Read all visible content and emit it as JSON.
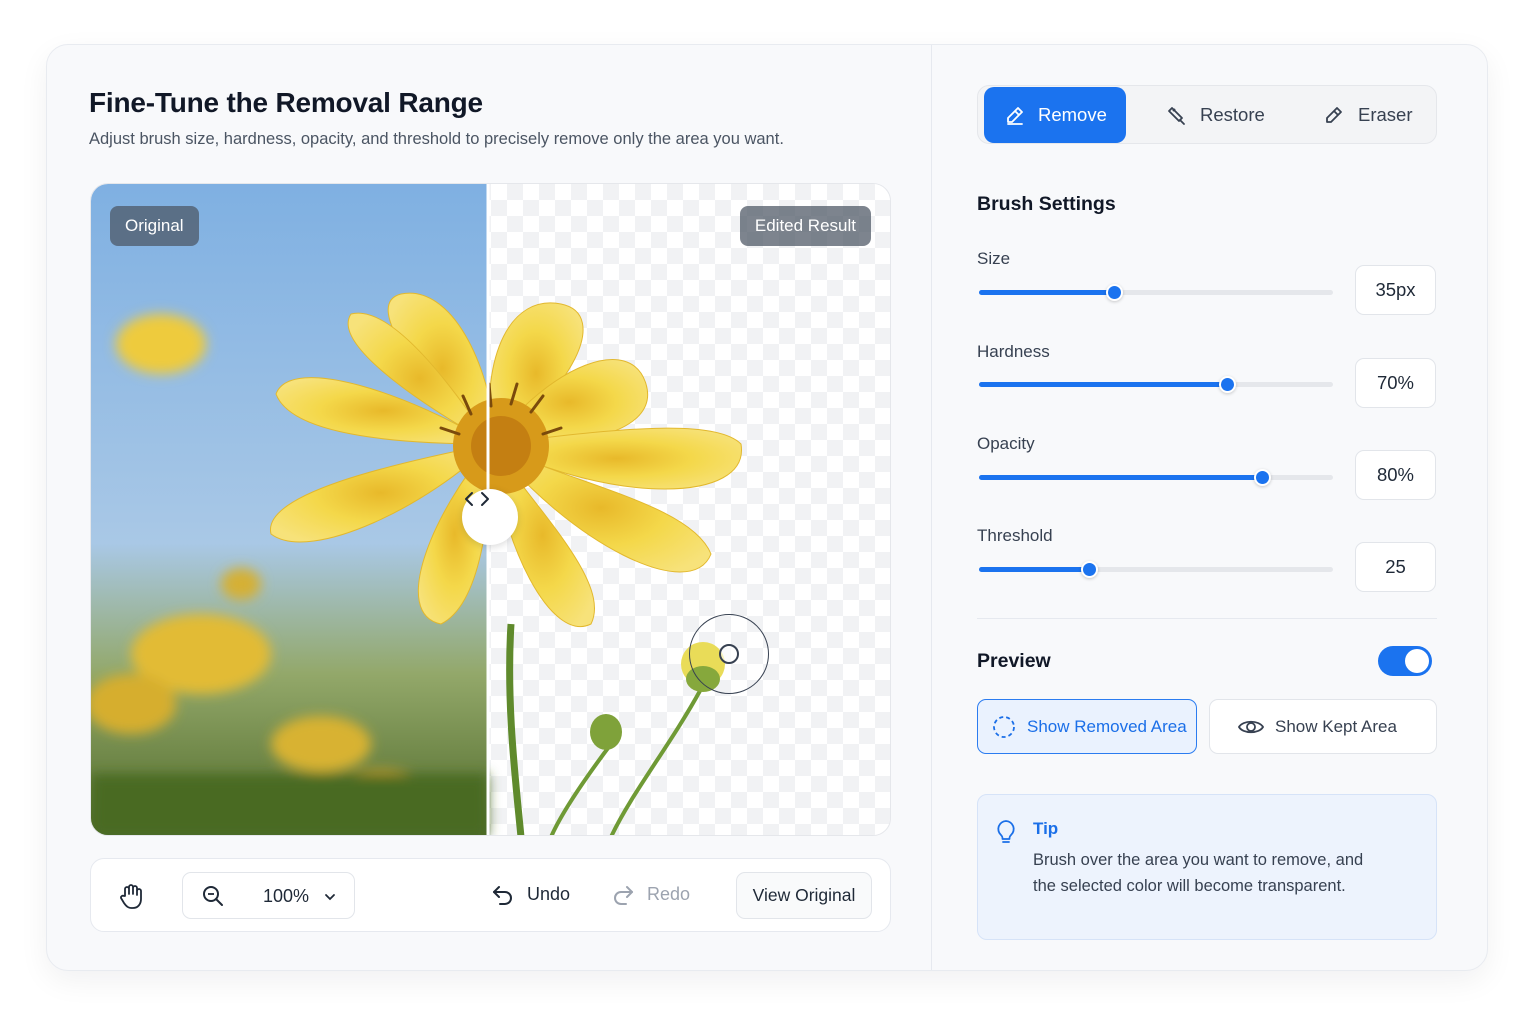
{
  "header": {
    "title": "Fine-Tune the Removal Range",
    "subtitle": "Adjust brush size, hardness, opacity, and threshold to precisely remove only the area you want."
  },
  "canvas": {
    "badge_left": "Original",
    "badge_right": "Edited Result",
    "split_handle_icon": "chevrons-left-right-icon",
    "split_position": 0.497
  },
  "toolbar": {
    "hand_icon": "hand-icon",
    "zoom_icon": "zoom-in-icon",
    "zoom_value": "100%",
    "undo_label": "Undo",
    "redo_label": "Redo",
    "view_original_label": "View Original"
  },
  "modes": [
    {
      "label": "Remove",
      "icon": "brush-remove-icon",
      "active": true
    },
    {
      "label": "Restore",
      "icon": "restore-brush-icon",
      "active": false
    },
    {
      "label": "Eraser",
      "icon": "eraser-icon",
      "active": false
    }
  ],
  "brush_settings": {
    "heading": "Brush Settings",
    "sliders": [
      {
        "label": "Size",
        "value": "35px",
        "level": 0.38
      },
      {
        "label": "Hardness",
        "value": "70%",
        "level": 0.7
      },
      {
        "label": "Opacity",
        "value": "80%",
        "level": 0.8
      },
      {
        "label": "Threshold",
        "value": "25",
        "level": 0.31
      }
    ]
  },
  "preview": {
    "heading": "Preview",
    "toggle_on": true,
    "show_removed_label": "Show Removed Area",
    "show_kept_label": "Show Kept Area"
  },
  "tip": {
    "title": "Tip",
    "text": "Brush over the area you want to remove, and the selected color will become transparent."
  },
  "colors": {
    "accent": "#1b73ef",
    "petal": "#f2d23a",
    "sky": "#7fb2e3"
  }
}
